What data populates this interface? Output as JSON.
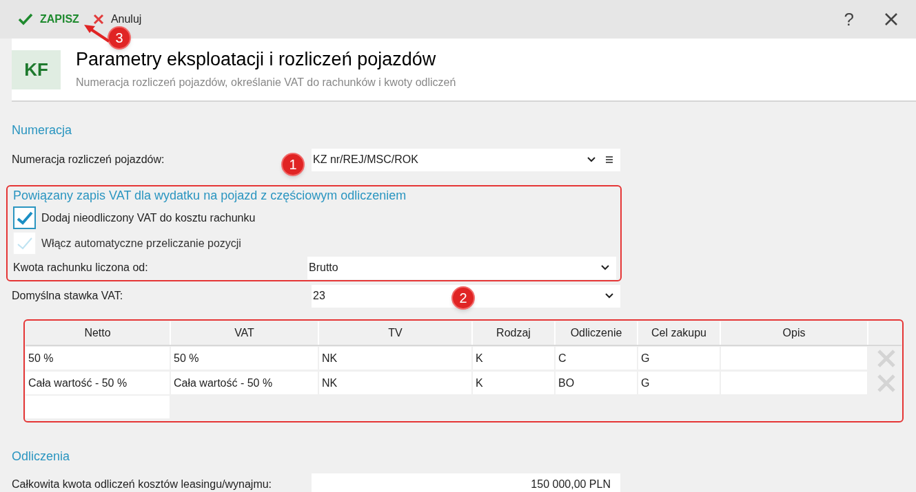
{
  "toolbar": {
    "save": "ZAPISZ",
    "cancel": "Anuluj",
    "help": "?"
  },
  "header": {
    "badge": "KF",
    "title": "Parametry eksploatacji i rozliczeń pojazdów",
    "subtitle": "Numeracja rozliczeń pojazdów, określanie VAT do rachunków i kwoty odliczeń"
  },
  "numeracja": {
    "heading": "Numeracja",
    "label": "Numeracja rozliczeń pojazdów:",
    "value": "KZ nr/REJ/MSC/ROK"
  },
  "vat_section": {
    "heading": "Powiązany zapis VAT dla wydatku na pojazd z częściowym odliczeniem",
    "checkboxes": [
      {
        "label": "Dodaj nieodliczony VAT do kosztu rachunku",
        "checked": true,
        "disabled": false
      },
      {
        "label": "Włącz automatyczne przeliczanie pozycji",
        "checked": true,
        "disabled": true
      }
    ],
    "amount_label": "Kwota rachunku liczona od:",
    "amount_value": "Brutto"
  },
  "default_vat": {
    "label": "Domyślna stawka VAT:",
    "value": "23"
  },
  "table": {
    "columns": [
      "Netto",
      "VAT",
      "TV",
      "Rodzaj",
      "Odliczenie",
      "Cel zakupu",
      "Opis"
    ],
    "rows": [
      [
        "50 %",
        "50 %",
        "NK",
        "K",
        "C",
        "G",
        ""
      ],
      [
        "Cała wartość - 50 %",
        "Cała wartość - 50 %",
        "NK",
        "K",
        "BO",
        "G",
        ""
      ]
    ]
  },
  "odliczenia": {
    "heading": "Odliczenia",
    "label": "Całkowita kwota odliczeń kosztów leasingu/wynajmu:",
    "value": "150 000,00 PLN"
  },
  "markers": [
    "1",
    "2",
    "3"
  ]
}
